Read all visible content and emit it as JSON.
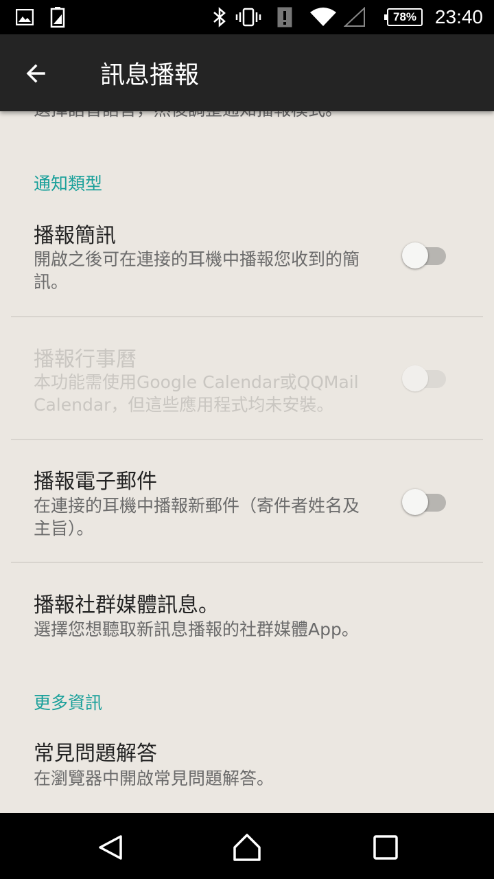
{
  "status_bar": {
    "time": "23:40",
    "battery": "78%",
    "icons": [
      "image-icon",
      "sim-icon",
      "bluetooth-icon",
      "vibrate-icon",
      "alert-icon",
      "wifi-icon",
      "signal-icon"
    ]
  },
  "app_bar": {
    "title": "訊息播報",
    "back_icon": "arrow-left-icon"
  },
  "content": {
    "cut_off_text": "選擇語音語言，然後調整通知播報模式。",
    "section_notification_types": "通知類型",
    "items": [
      {
        "title": "播報簡訊",
        "summary": "開啟之後可在連接的耳機中播報您收到的簡訊。",
        "switch": "off",
        "enabled": true
      },
      {
        "title": "播報行事曆",
        "summary": "本功能需使用Google Calendar或QQMail Calendar，但這些應用程式均未安裝。",
        "switch": "off",
        "enabled": false
      },
      {
        "title": "播報電子郵件",
        "summary": "在連接的耳機中播報新郵件（寄件者姓名及主旨）。",
        "switch": "off",
        "enabled": true
      },
      {
        "title": "播報社群媒體訊息。",
        "summary": "選擇您想聽取新訊息播報的社群媒體App。"
      }
    ],
    "section_more_info": "更多資訊",
    "faq": {
      "title": "常見問題解答",
      "summary": "在瀏覽器中開啟常見問題解答。"
    }
  },
  "nav_bar": {
    "icons": [
      "back-triangle-icon",
      "home-icon",
      "recents-icon"
    ]
  },
  "colors": {
    "accent": "#19a09a",
    "background": "#ebe7e1",
    "app_bar": "#242424"
  }
}
